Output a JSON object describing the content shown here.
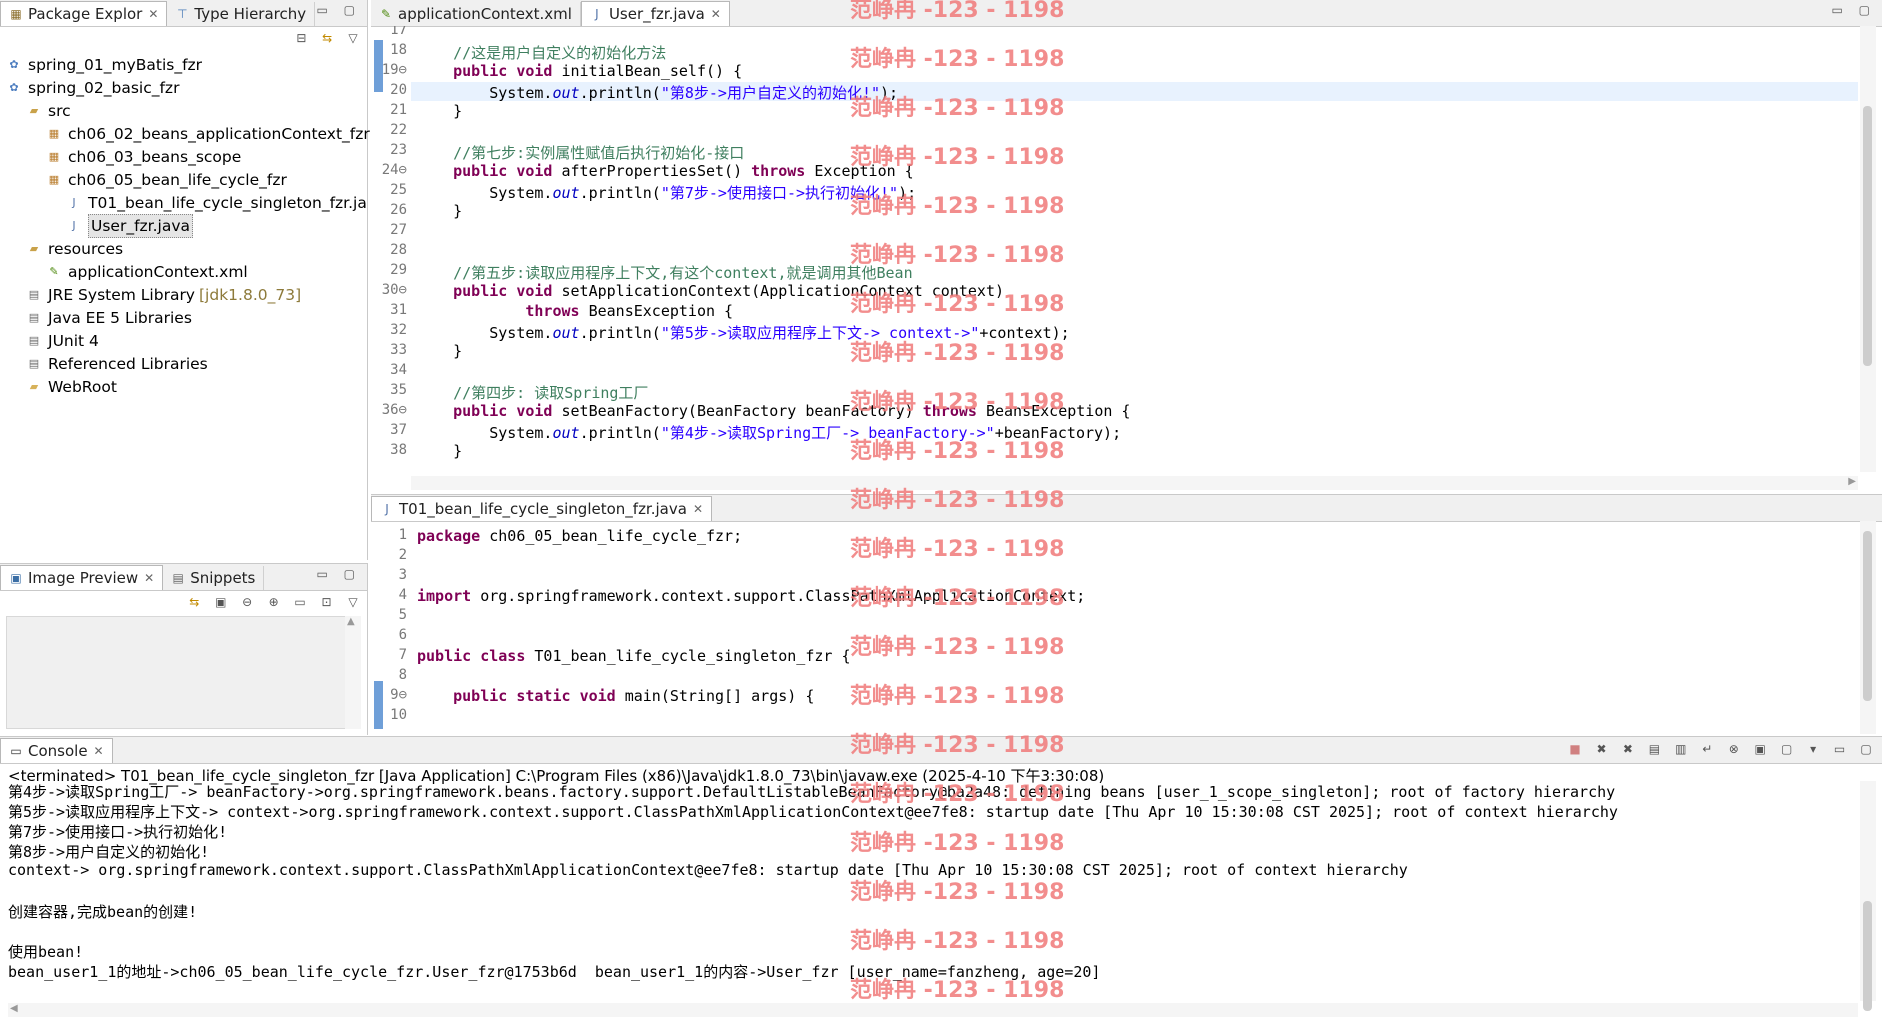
{
  "package_explorer": {
    "tabs": [
      {
        "label": "Package Explor",
        "active": true
      },
      {
        "label": "Type Hierarchy",
        "active": false
      }
    ],
    "items": [
      {
        "label": "spring_01_myBatis_fzr",
        "icon": "project-icon",
        "level": 1
      },
      {
        "label": "spring_02_basic_fzr",
        "icon": "project-icon",
        "level": 1
      },
      {
        "label": "src",
        "icon": "source-folder-icon",
        "level": 2
      },
      {
        "label": "ch06_02_beans_applicationContext_fzr",
        "icon": "package-icon",
        "level": 3
      },
      {
        "label": "ch06_03_beans_scope",
        "icon": "package-icon",
        "level": 3
      },
      {
        "label": "ch06_05_bean_life_cycle_fzr",
        "icon": "package-icon",
        "level": 3
      },
      {
        "label": "T01_bean_life_cycle_singleton_fzr.ja",
        "icon": "java-file-icon",
        "level": 4
      },
      {
        "label": "User_fzr.java",
        "icon": "java-file-icon",
        "level": 4,
        "selected": true
      },
      {
        "label": "resources",
        "icon": "source-folder-icon",
        "level": 2
      },
      {
        "label": "applicationContext.xml",
        "icon": "xml-file-icon",
        "level": 3
      },
      {
        "label": "JRE System Library",
        "suffix": "[jdk1.8.0_73]",
        "icon": "library-icon",
        "level": 2
      },
      {
        "label": "Java EE 5 Libraries",
        "icon": "library-icon",
        "level": 2
      },
      {
        "label": "JUnit 4",
        "icon": "library-icon",
        "level": 2
      },
      {
        "label": "Referenced Libraries",
        "icon": "library-icon",
        "level": 2
      },
      {
        "label": "WebRoot",
        "icon": "folder-icon",
        "level": 2
      }
    ]
  },
  "image_preview": {
    "tabs": [
      {
        "label": "Image Preview",
        "active": true
      },
      {
        "label": "Snippets",
        "active": false
      }
    ]
  },
  "editor_top": {
    "tabs": [
      {
        "label": "applicationContext.xml",
        "active": false
      },
      {
        "label": "User_fzr.java",
        "active": true
      }
    ],
    "lines": [
      {
        "n": "17",
        "html": ""
      },
      {
        "n": "18",
        "html": "    <span class=\"cm\">//这是用户自定义的初始化方法</span>"
      },
      {
        "n": "19⊖",
        "html": "    <span class=\"kw\">public</span> <span class=\"kw\">void</span> initialBean_self() {"
      },
      {
        "n": "20",
        "html": "        System.<span class=\"it\">out</span>.println(<span class=\"st\">\"第8步->用户自定义的初始化!\"</span>);"
      },
      {
        "n": "21",
        "html": "    }"
      },
      {
        "n": "22",
        "html": ""
      },
      {
        "n": "23",
        "html": "    <span class=\"cm\">//第七步:实例属性赋值后执行初始化-接口</span>"
      },
      {
        "n": "24⊖",
        "html": "    <span class=\"kw\">public</span> <span class=\"kw\">void</span> afterPropertiesSet() <span class=\"kw\">throws</span> Exception {"
      },
      {
        "n": "25",
        "html": "        System.<span class=\"it\">out</span>.println(<span class=\"st\">\"第7步->使用接口->执行初始化!\"</span>);"
      },
      {
        "n": "26",
        "html": "    }"
      },
      {
        "n": "27",
        "html": ""
      },
      {
        "n": "28",
        "html": ""
      },
      {
        "n": "29",
        "html": "    <span class=\"cm\">//第五步:读取应用程序上下文,有这个context,就是调用其他Bean</span>"
      },
      {
        "n": "30⊖",
        "html": "    <span class=\"kw\">public</span> <span class=\"kw\">void</span> setApplicationContext(ApplicationContext context)"
      },
      {
        "n": "31",
        "html": "            <span class=\"kw\">throws</span> BeansException {"
      },
      {
        "n": "32",
        "html": "        System.<span class=\"it\">out</span>.println(<span class=\"st\">\"第5步->读取应用程序上下文-> context->\"</span>+context);"
      },
      {
        "n": "33",
        "html": "    }"
      },
      {
        "n": "34",
        "html": ""
      },
      {
        "n": "35",
        "html": "    <span class=\"cm\">//第四步: 读取Spring工厂</span>"
      },
      {
        "n": "36⊖",
        "html": "    <span class=\"kw\">public</span> <span class=\"kw\">void</span> setBeanFactory(BeanFactory beanFactory) <span class=\"kw\">throws</span> BeansException {"
      },
      {
        "n": "37",
        "html": "        System.<span class=\"it\">out</span>.println(<span class=\"st\">\"第4步->读取Spring工厂-> beanFactory->\"</span>+beanFactory);"
      },
      {
        "n": "38",
        "html": "    }"
      }
    ]
  },
  "editor_bottom": {
    "tabs": [
      {
        "label": "T01_bean_life_cycle_singleton_fzr.java",
        "active": true
      }
    ],
    "lines": [
      {
        "n": "1",
        "html": "<span class=\"kw\">package</span> ch06_05_bean_life_cycle_fzr;"
      },
      {
        "n": "2",
        "html": ""
      },
      {
        "n": "3",
        "html": ""
      },
      {
        "n": "4",
        "html": "<span class=\"kw\">import</span> org.springframework.context.support.ClassPathXmlApplicationContext;"
      },
      {
        "n": "5",
        "html": ""
      },
      {
        "n": "6",
        "html": ""
      },
      {
        "n": "7",
        "html": "<span class=\"kw\">public</span> <span class=\"kw\">class</span> T01_bean_life_cycle_singleton_fzr {"
      },
      {
        "n": "8",
        "html": ""
      },
      {
        "n": "9⊖",
        "html": "    <span class=\"kw\">public</span> <span class=\"kw\">static</span> <span class=\"kw\">void</span> main(String[] args) {"
      },
      {
        "n": "10",
        "html": ""
      }
    ]
  },
  "console": {
    "tab_label": "Console",
    "header": "<terminated> T01_bean_life_cycle_singleton_fzr [Java Application] C:\\Program Files (x86)\\Java\\jdk1.8.0_73\\bin\\javaw.exe (2025-4-10 下午3:30:08)",
    "lines": [
      "第4步->读取Spring工厂-> beanFactory->org.springframework.beans.factory.support.DefaultListableBeanFactory@ba2a48: defining beans [user_1_scope_singleton]; root of factory hierarchy",
      "第5步->读取应用程序上下文-> context->org.springframework.context.support.ClassPathXmlApplicationContext@ee7fe8: startup date [Thu Apr 10 15:30:08 CST 2025]; root of context hierarchy",
      "第7步->使用接口->执行初始化!",
      "第8步->用户自定义的初始化!",
      "context-> org.springframework.context.support.ClassPathXmlApplicationContext@ee7fe8: startup date [Thu Apr 10 15:30:08 CST 2025]; root of context hierarchy",
      "",
      "创建容器,完成bean的创建!",
      "",
      "使用bean!",
      "bean_user1_1的地址->ch06_05_bean_life_cycle_fzr.User_fzr@1753b6d  bean_user1_1的内容->User_fzr [user_name=fanzheng, age=20]"
    ]
  },
  "watermark": "范峥冉 -123 - 1198",
  "colors": {
    "keyword": "#7f0055",
    "comment": "#3f7f5f",
    "string": "#2a00ff",
    "field": "#0000c0",
    "watermark": "#f07a7a"
  }
}
